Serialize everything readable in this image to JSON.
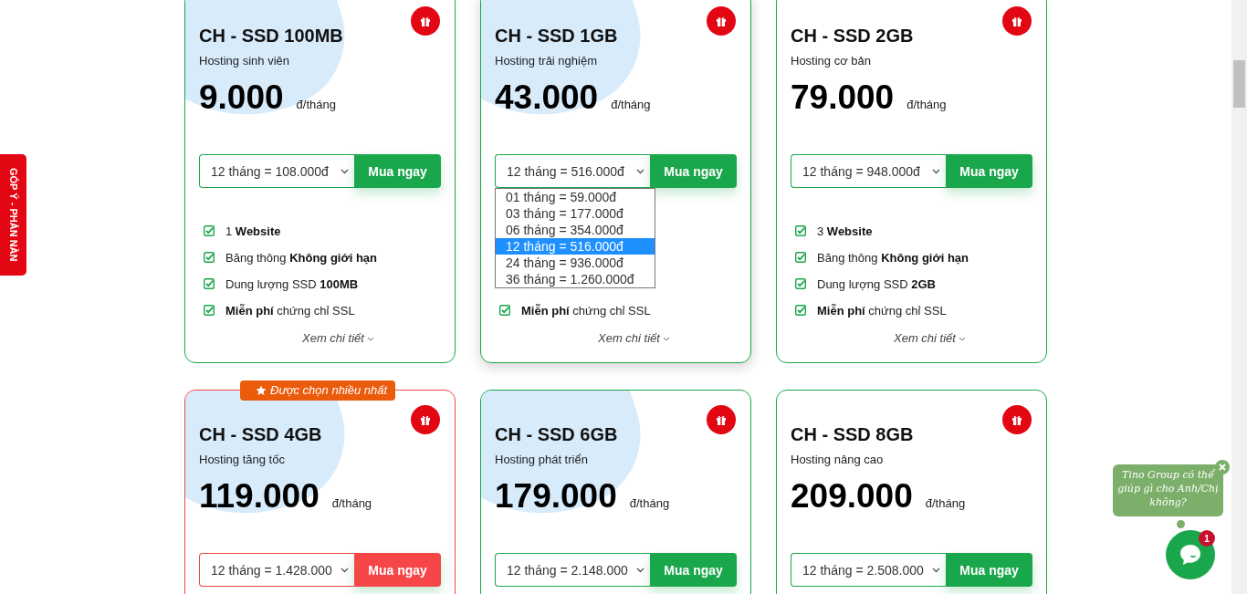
{
  "feedback_tab": {
    "label": "GÓP Ý - PHẢN NÀN"
  },
  "plans": [
    {
      "name": "CH - SSD 100MB",
      "subtitle": "Hosting sinh viên",
      "price": "9.000",
      "unit": "đ/tháng",
      "featured": false,
      "hovered": false,
      "accent_shape": true,
      "term": "12 tháng = 108.000đ",
      "buy_label": "Mua ngay",
      "features": [
        "1 **Website**",
        "Băng thông **Không giới hạn**",
        "Dung lượng SSD **100MB**",
        "**Miễn phí** chứng chỉ SSL"
      ],
      "details_label": "Xem chi tiết"
    },
    {
      "name": "CH - SSD 1GB",
      "subtitle": "Hosting trải nghiệm",
      "price": "43.000",
      "unit": "đ/tháng",
      "featured": false,
      "hovered": true,
      "accent_shape": true,
      "term": "12 tháng = 516.000đ",
      "buy_label": "Mua ngay",
      "term_options": [
        {
          "label": "01 tháng = 59.000đ",
          "selected": false
        },
        {
          "label": "03 tháng = 177.000đ",
          "selected": false
        },
        {
          "label": "06 tháng = 354.000đ",
          "selected": false
        },
        {
          "label": "12 tháng = 516.000đ",
          "selected": true
        },
        {
          "label": "24 tháng = 936.000đ",
          "selected": false
        },
        {
          "label": "36 tháng = 1.260.000đ",
          "selected": false
        }
      ],
      "features": [
        "**Miễn phí** chứng chỉ SSL"
      ],
      "details_label": "Xem chi tiết"
    },
    {
      "name": "CH - SSD 2GB",
      "subtitle": "Hosting cơ bản",
      "price": "79.000",
      "unit": "đ/tháng",
      "featured": false,
      "hovered": false,
      "accent_shape": false,
      "term": "12 tháng = 948.000đ",
      "buy_label": "Mua ngay",
      "features": [
        "3 **Website**",
        "Băng thông **Không giới hạn**",
        "Dung lượng SSD **2GB**",
        "**Miễn phí** chứng chỉ SSL"
      ],
      "details_label": "Xem chi tiết"
    },
    {
      "name": "CH - SSD 4GB",
      "subtitle": "Hosting tăng tốc",
      "price": "119.000",
      "unit": "đ/tháng",
      "featured": true,
      "hovered": false,
      "accent_shape": true,
      "badge": "Được chọn nhiều nhất",
      "term": "12 tháng = 1.428.000",
      "buy_label": "Mua ngay"
    },
    {
      "name": "CH - SSD 6GB",
      "subtitle": "Hosting phát triển",
      "price": "179.000",
      "unit": "đ/tháng",
      "featured": false,
      "hovered": false,
      "accent_shape": true,
      "term": "12 tháng = 2.148.000",
      "buy_label": "Mua ngay"
    },
    {
      "name": "CH - SSD 8GB",
      "subtitle": "Hosting nâng cao",
      "price": "209.000",
      "unit": "đ/tháng",
      "featured": false,
      "hovered": false,
      "accent_shape": false,
      "term": "12 tháng = 2.508.000",
      "buy_label": "Mua ngay"
    }
  ],
  "chat": {
    "message": "Tino Group có thể giúp gì cho Anh/Chị không?",
    "badge": "1"
  }
}
